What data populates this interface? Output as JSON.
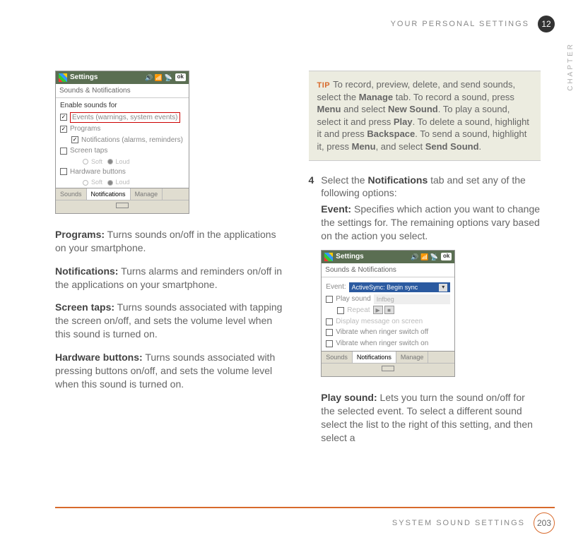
{
  "header": {
    "section": "YOUR PERSONAL SETTINGS",
    "chapter_num": "12",
    "chapter_label": "CHAPTER"
  },
  "footer": {
    "section": "SYSTEM SOUND SETTINGS",
    "page": "203"
  },
  "shot1": {
    "app": "Settings",
    "ok": "ok",
    "subtitle": "Sounds & Notifications",
    "heading": "Enable sounds for",
    "items": {
      "events": "Events (warnings, system events)",
      "programs": "Programs",
      "notifications": "Notifications (alarms, reminders)",
      "screen_taps": "Screen taps",
      "hw_buttons": "Hardware buttons"
    },
    "radios": {
      "soft": "Soft",
      "loud": "Loud"
    },
    "tabs": {
      "sounds": "Sounds",
      "notifications": "Notifications",
      "manage": "Manage"
    }
  },
  "left_paras": {
    "programs_b": "Programs:",
    "programs_t": " Turns sounds on/off in the applications on your smartphone.",
    "notif_b": "Notifications:",
    "notif_t": " Turns alarms and reminders on/off in the applications on your smartphone.",
    "taps_b": "Screen taps:",
    "taps_t": " Turns sounds associated with tapping the screen on/off, and sets the volume level when this sound is turned on.",
    "hw_b": "Hardware buttons:",
    "hw_t": " Turns sounds associated with pressing buttons on/off, and sets the volume level when this sound is turned on."
  },
  "tip": {
    "label": "TIP",
    "t1": "To record, preview, delete, and send sounds, select the ",
    "b1": "Manage",
    "t2": " tab. To record a sound, press ",
    "b2": "Menu",
    "t3": " and select ",
    "b3": "New Sound",
    "t4": ". To play a sound, select it and press ",
    "b4": "Play",
    "t5": ". To delete a sound, highlight it and press ",
    "b5": "Backspace",
    "t6": ". To send a sound, highlight it, press ",
    "b6": "Menu",
    "t7": ", and select ",
    "b7": "Send Sound",
    "t8": "."
  },
  "step4": {
    "num": "4",
    "t1": "Select the ",
    "b1": "Notifications",
    "t2": " tab and set any of the following options:",
    "event_b": "Event:",
    "event_t": " Specifies which action you want to change the settings for. The remaining options vary based on the action you select."
  },
  "shot2": {
    "app": "Settings",
    "ok": "ok",
    "subtitle": "Sounds & Notifications",
    "event_label": "Event:",
    "event_value": "ActiveSync: Begin sync",
    "play_sound": "Play sound",
    "play_value": "Infbeg",
    "repeat": "Repeat",
    "disp_msg": "Display message on screen",
    "vib_off": "Vibrate when ringer switch off",
    "vib_on": "Vibrate when ringer switch on",
    "tabs": {
      "sounds": "Sounds",
      "notifications": "Notifications",
      "manage": "Manage"
    }
  },
  "play_sound_para": {
    "b": "Play sound:",
    "t": " Lets you turn the sound on/off for the selected event. To select a different sound select the list to the right of this setting, and then select a"
  }
}
